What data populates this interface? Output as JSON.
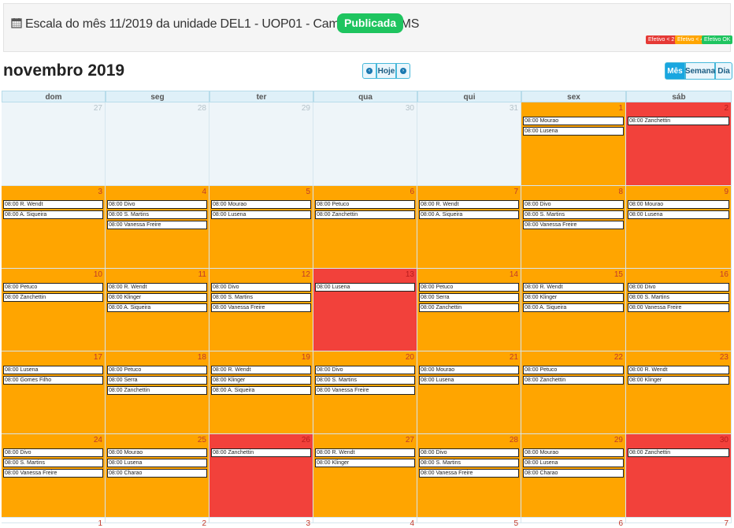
{
  "header": {
    "title": "Escala do mês 11/2019 da unidade DEL1 - UOP01 - Campo Grande/MS",
    "status_badge": "Publicada",
    "legend": [
      "Efetivo < 2",
      "Efetivo < 4",
      "Efetivo OK"
    ]
  },
  "toolbar": {
    "month_title": "novembro 2019",
    "today_label": "Hoje",
    "views": [
      "Mês",
      "Semana",
      "Dia"
    ]
  },
  "colors": {
    "other": "#eef5f9",
    "orange": "#ffa500",
    "red": "#f2413b",
    "badge": "#1ec45f"
  },
  "calendar": {
    "weekdays": [
      "dom",
      "seg",
      "ter",
      "qua",
      "qui",
      "sex",
      "sáb"
    ],
    "weeks": [
      [
        {
          "day": "27",
          "status": "other",
          "events": []
        },
        {
          "day": "28",
          "status": "other",
          "events": []
        },
        {
          "day": "29",
          "status": "other",
          "events": []
        },
        {
          "day": "30",
          "status": "other",
          "events": []
        },
        {
          "day": "31",
          "status": "other",
          "events": []
        },
        {
          "day": "1",
          "status": "orange",
          "events": [
            "08:00 Mourao",
            "08:00 Lusena"
          ]
        },
        {
          "day": "2",
          "status": "red",
          "events": [
            "08:00 Zanchettin"
          ]
        }
      ],
      [
        {
          "day": "3",
          "status": "orange",
          "events": [
            "08:00 R. Wendt",
            "08:00 A. Siqueira"
          ]
        },
        {
          "day": "4",
          "status": "orange",
          "events": [
            "08:00 Divo",
            "08:00 S. Martins",
            "08:00 Vanessa Freire"
          ]
        },
        {
          "day": "5",
          "status": "orange",
          "events": [
            "08:00 Mourao",
            "08:00 Lusena"
          ]
        },
        {
          "day": "6",
          "status": "orange",
          "events": [
            "08:00 Petuco",
            "08:00 Zanchettin"
          ]
        },
        {
          "day": "7",
          "status": "orange",
          "events": [
            "08:00 R. Wendt",
            "08:00 A. Siqueira"
          ]
        },
        {
          "day": "8",
          "status": "orange",
          "events": [
            "08:00 Divo",
            "08:00 S. Martins",
            "08:00 Vanessa Freire"
          ]
        },
        {
          "day": "9",
          "status": "orange",
          "events": [
            "08:00 Mourao",
            "08:00 Lusena"
          ]
        }
      ],
      [
        {
          "day": "10",
          "status": "orange",
          "events": [
            "08:00 Petuco",
            "08:00 Zanchettin"
          ]
        },
        {
          "day": "11",
          "status": "orange",
          "events": [
            "08:00 R. Wendt",
            "08:00 Klinger",
            "08:00 A. Siqueira"
          ]
        },
        {
          "day": "12",
          "status": "orange",
          "events": [
            "08:00 Divo",
            "08:00 S. Martins",
            "08:00 Vanessa Freire"
          ]
        },
        {
          "day": "13",
          "status": "red",
          "events": [
            "08:00 Lusena"
          ]
        },
        {
          "day": "14",
          "status": "orange",
          "events": [
            "08:00 Petuco",
            "08:00 Serra",
            "08:00 Zanchettin"
          ]
        },
        {
          "day": "15",
          "status": "orange",
          "events": [
            "08:00 R. Wendt",
            "08:00 Klinger",
            "08:00 A. Siqueira"
          ]
        },
        {
          "day": "16",
          "status": "orange",
          "events": [
            "08:00 Divo",
            "08:00 S. Martins",
            "08:00 Vanessa Freire"
          ]
        }
      ],
      [
        {
          "day": "17",
          "status": "orange",
          "events": [
            "08:00 Lusena",
            "08:00 Gomes Filho"
          ]
        },
        {
          "day": "18",
          "status": "orange",
          "events": [
            "08:00 Petuco",
            "08:00 Serra",
            "08:00 Zanchettin"
          ]
        },
        {
          "day": "19",
          "status": "orange",
          "events": [
            "08:00 R. Wendt",
            "08:00 Klinger",
            "08:00 A. Siqueira"
          ]
        },
        {
          "day": "20",
          "status": "orange",
          "events": [
            "08:00 Divo",
            "08:00 S. Martins",
            "08:00 Vanessa Freire"
          ]
        },
        {
          "day": "21",
          "status": "orange",
          "events": [
            "08:00 Mourao",
            "08:00 Lusena"
          ]
        },
        {
          "day": "22",
          "status": "orange",
          "events": [
            "08:00 Petuco",
            "08:00 Zanchettin"
          ]
        },
        {
          "day": "23",
          "status": "orange",
          "events": [
            "08:00 R. Wendt",
            "08:00 Klinger"
          ]
        }
      ],
      [
        {
          "day": "24",
          "status": "orange",
          "events": [
            "08:00 Divo",
            "08:00 S. Martins",
            "08:00 Vanessa Freire"
          ]
        },
        {
          "day": "25",
          "status": "orange",
          "events": [
            "08:00 Mourao",
            "08:00 Lusena",
            "08:00 Charao"
          ]
        },
        {
          "day": "26",
          "status": "red",
          "events": [
            "08:00 Zanchettin"
          ]
        },
        {
          "day": "27",
          "status": "orange",
          "events": [
            "08:00 R. Wendt",
            "08:00 Klinger"
          ]
        },
        {
          "day": "28",
          "status": "orange",
          "events": [
            "08:00 Divo",
            "08:00 S. Martins",
            "08:00 Vanessa Freire"
          ]
        },
        {
          "day": "29",
          "status": "orange",
          "events": [
            "08:00 Mourao",
            "08:00 Lusena",
            "08:00 Charao"
          ]
        },
        {
          "day": "30",
          "status": "red",
          "events": [
            "08:00 Zanchettin"
          ]
        }
      ],
      [
        {
          "day": "1",
          "status": "white",
          "events": []
        },
        {
          "day": "2",
          "status": "white",
          "events": []
        },
        {
          "day": "3",
          "status": "white",
          "events": []
        },
        {
          "day": "4",
          "status": "white",
          "events": []
        },
        {
          "day": "5",
          "status": "white",
          "events": []
        },
        {
          "day": "6",
          "status": "white",
          "events": []
        },
        {
          "day": "7",
          "status": "white",
          "events": []
        }
      ]
    ]
  }
}
